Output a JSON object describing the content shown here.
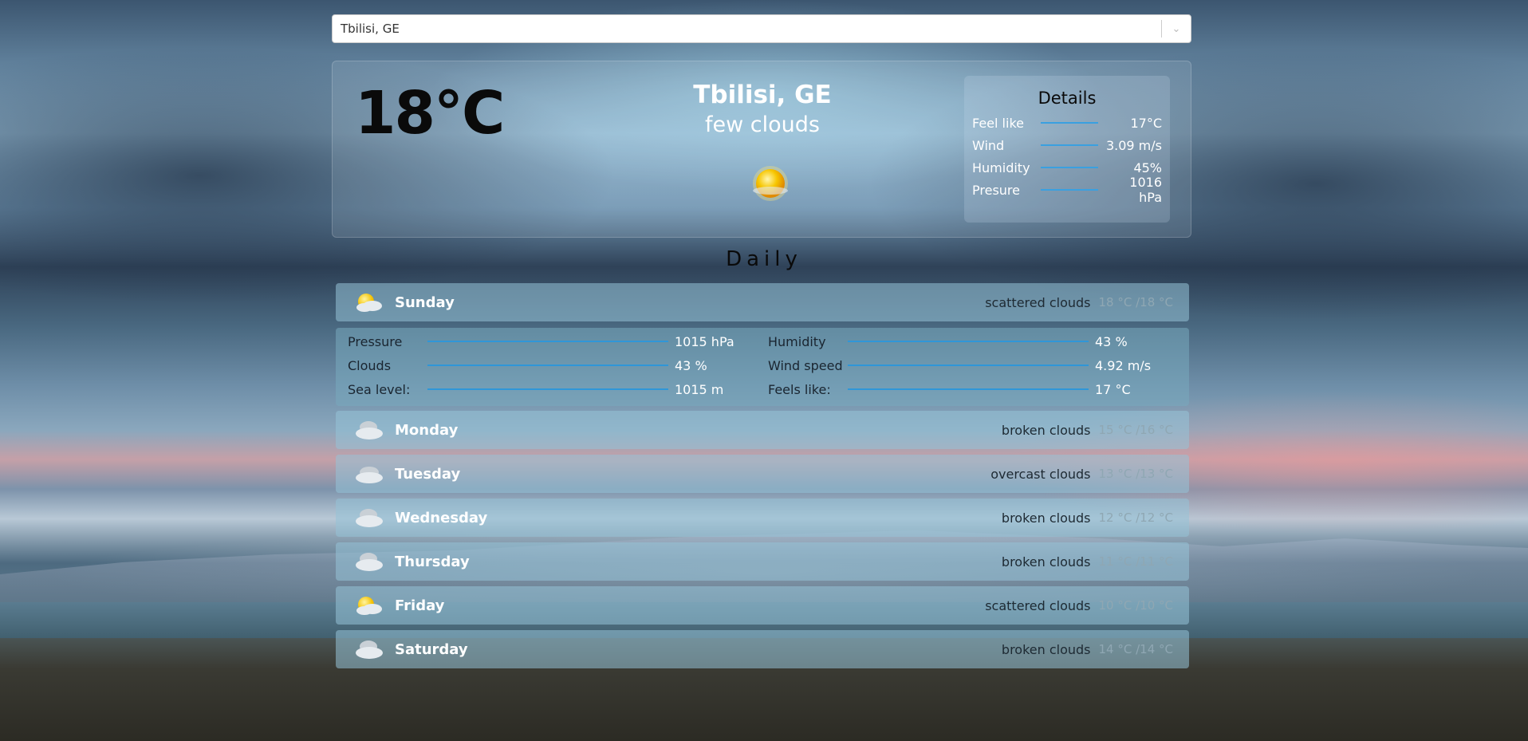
{
  "search": {
    "value": "Tbilisi, GE"
  },
  "current": {
    "temperature": "18°C",
    "city": "Tbilisi, GE",
    "description": "few clouds",
    "icon": "sun-icon"
  },
  "details": {
    "title": "Details",
    "rows": [
      {
        "label": "Feel like",
        "value": "17°C"
      },
      {
        "label": "Wind",
        "value": "3.09 m/s"
      },
      {
        "label": "Humidity",
        "value": "45%"
      },
      {
        "label": "Presure",
        "value": "1016 hPa"
      }
    ]
  },
  "daily": {
    "title": "Daily",
    "days": [
      {
        "day": "Sunday",
        "condition": "scattered clouds",
        "minmax": "18 °C /18 °C",
        "icon": "scattered-clouds-icon"
      },
      {
        "day": "Monday",
        "condition": "broken clouds",
        "minmax": "15 °C /16 °C",
        "icon": "broken-clouds-icon"
      },
      {
        "day": "Tuesday",
        "condition": "overcast clouds",
        "minmax": "13 °C /13 °C",
        "icon": "overcast-clouds-icon"
      },
      {
        "day": "Wednesday",
        "condition": "broken clouds",
        "minmax": "12 °C /12 °C",
        "icon": "broken-clouds-icon"
      },
      {
        "day": "Thursday",
        "condition": "broken clouds",
        "minmax": "11 °C /11 °C",
        "icon": "broken-clouds-icon"
      },
      {
        "day": "Friday",
        "condition": "scattered clouds",
        "minmax": "10 °C /10 °C",
        "icon": "scattered-clouds-icon"
      },
      {
        "day": "Saturday",
        "condition": "broken clouds",
        "minmax": "14 °C /14 °C",
        "icon": "broken-clouds-icon"
      }
    ],
    "expanded": {
      "left": [
        {
          "label": "Pressure",
          "value": "1015 hPa"
        },
        {
          "label": "Clouds",
          "value": "43 %"
        },
        {
          "label": "Sea level:",
          "value": "1015 m"
        }
      ],
      "right": [
        {
          "label": "Humidity",
          "value": "43 %"
        },
        {
          "label": "Wind speed",
          "value": "4.92 m/s"
        },
        {
          "label": "Feels like:",
          "value": "17 °C"
        }
      ]
    }
  }
}
